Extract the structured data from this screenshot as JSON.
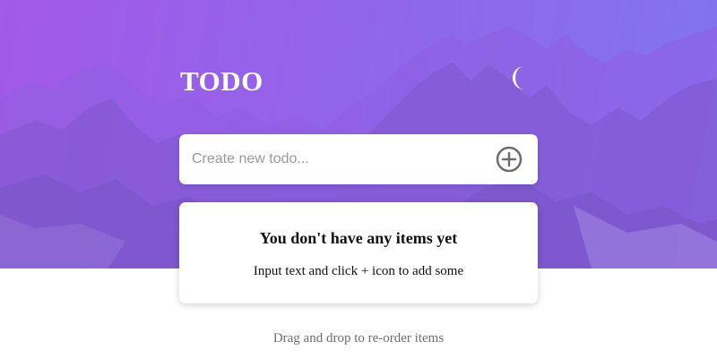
{
  "header": {
    "title": "TODO",
    "theme_toggle_icon": "moon-icon"
  },
  "input": {
    "placeholder": "Create new todo...",
    "value": "",
    "add_icon": "plus-circle-icon"
  },
  "list": {
    "empty_title": "You don't have any items yet",
    "empty_subtitle": "Input text and click + icon to add some"
  },
  "footer": {
    "hint": "Drag and drop to re-order items"
  },
  "colors": {
    "gradient_start": "#a35ae6",
    "gradient_end": "#8174ee",
    "card_bg": "#ffffff",
    "icon_gray": "#6e6e6e"
  }
}
